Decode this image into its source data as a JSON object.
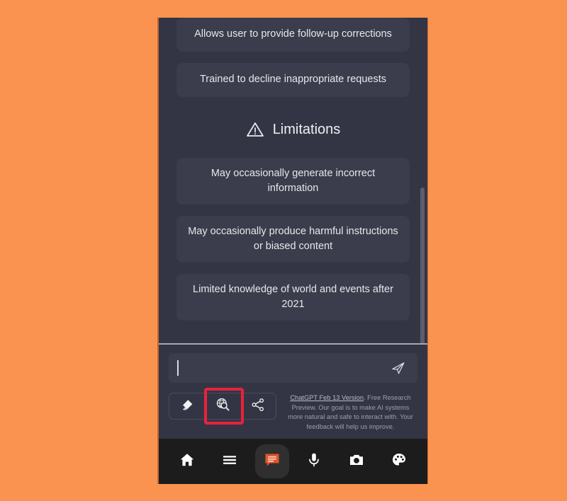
{
  "theme": {
    "page_background": "#fb9350",
    "app_background": "#343544",
    "card_background": "#3c3d4c",
    "text_primary": "#e6e7ec",
    "accent_orange": "#e0552a",
    "highlight_red": "#e8233a",
    "nav_background": "#1c1c1c"
  },
  "chat": {
    "capability_cards": [
      {
        "text": "Allows user to provide follow-up corrections"
      },
      {
        "text": "Trained to decline inappropriate requests"
      }
    ],
    "limitations_section": {
      "icon": "warning-triangle-icon",
      "title": "Limitations",
      "cards": [
        {
          "text": "May occasionally generate incorrect information"
        },
        {
          "text": "May occasionally produce harmful instructions or biased content"
        },
        {
          "text": "Limited knowledge of world and events after 2021"
        }
      ]
    }
  },
  "composer": {
    "input": {
      "value": "",
      "placeholder": ""
    },
    "send_icon": "send-paper-plane-icon",
    "toolbar": [
      {
        "icon": "eraser-icon",
        "name": "clear-conversation-button",
        "highlighted": false
      },
      {
        "icon": "globe-search-icon",
        "name": "web-search-button",
        "highlighted": true
      },
      {
        "icon": "share-icon",
        "name": "share-button",
        "highlighted": false
      }
    ],
    "footer": {
      "link_text": "ChatGPT Feb 13 Version",
      "body_text": ". Free Research Preview. Our goal is to make AI systems more natural and safe to interact with. Your feedback will help us improve."
    }
  },
  "bottom_nav": {
    "items": [
      {
        "icon": "home-icon",
        "name": "nav-home",
        "active": false
      },
      {
        "icon": "menu-icon",
        "name": "nav-menu",
        "active": false
      },
      {
        "icon": "chat-bubble-icon",
        "name": "nav-chat",
        "active": true
      },
      {
        "icon": "microphone-icon",
        "name": "nav-voice",
        "active": false
      },
      {
        "icon": "camera-icon",
        "name": "nav-camera",
        "active": false
      },
      {
        "icon": "palette-icon",
        "name": "nav-palette",
        "active": false
      }
    ]
  }
}
